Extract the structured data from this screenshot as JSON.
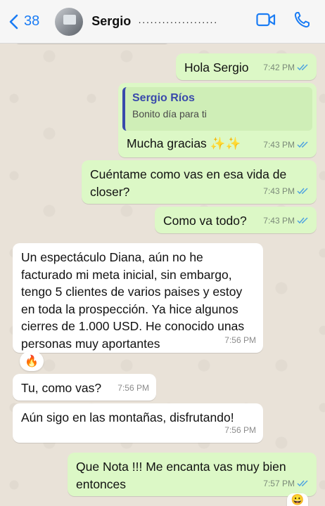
{
  "header": {
    "back_count": "38",
    "contact_name": "Sergio",
    "contact_obscured": "····················"
  },
  "messages": [
    {
      "id": "m1",
      "direction": "out",
      "text": "Hola Sergio",
      "time": "7:42 PM"
    },
    {
      "id": "m2",
      "direction": "out",
      "quote_name": "Sergio Ríos",
      "quote_text": "Bonito día para ti",
      "text": "Mucha gracias ✨✨",
      "time": "7:43 PM"
    },
    {
      "id": "m3",
      "direction": "out",
      "text": "Cuéntame como vas en esa vida de closer?",
      "time": "7:43 PM"
    },
    {
      "id": "m4",
      "direction": "out",
      "text": "Como va todo?",
      "time": "7:43 PM"
    },
    {
      "id": "m5",
      "direction": "in",
      "text": "Un espectáculo Diana, aún no he facturado mi meta inicial, sin embargo, tengo 5 clientes de varios paises y estoy en toda la prospección. Ya hice algunos cierres de 1.000 USD. He conocido unas personas muy aportantes",
      "time": "7:56 PM",
      "reaction": "🔥"
    },
    {
      "id": "m6",
      "direction": "in",
      "text": "Tu, como vas?",
      "time": "7:56 PM"
    },
    {
      "id": "m7",
      "direction": "in",
      "text": "Aún sigo en las montañas, disfrutando!",
      "time": "7:56 PM"
    },
    {
      "id": "m8",
      "direction": "out",
      "text": "Que Nota !!! Me encanta vas muy bien entonces",
      "time": "7:57 PM",
      "reaction": "😀"
    }
  ],
  "colors": {
    "outgoing_bubble": "#dcf8c6",
    "incoming_bubble": "#ffffff",
    "accent": "#1a7cf4",
    "read_ticks": "#4fa3e0"
  }
}
